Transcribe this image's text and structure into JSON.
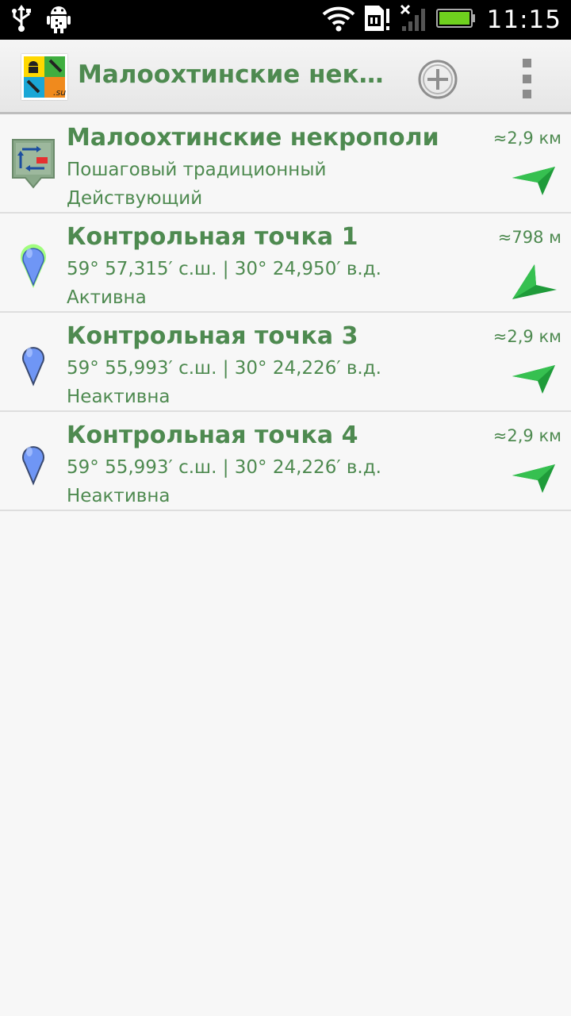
{
  "status_bar": {
    "time": "11:15",
    "icons": [
      "usb-icon",
      "android-debug-icon",
      "wifi-icon",
      "sim-icon",
      "signal-icon",
      "battery-icon"
    ]
  },
  "action_bar": {
    "title": "Малоохтинские нек…",
    "icons": [
      "app-logo-icon",
      "add-circle-icon",
      "overflow-menu-icon"
    ]
  },
  "colors": {
    "text_green": "#4e8a50",
    "arrow_green": "#1f9b3a",
    "pin_blue": "#6f96f5"
  },
  "items": [
    {
      "icon": "multistage-cache-icon",
      "title": "Малоохтинские некрополи",
      "line2": "Пошаговый традиционный",
      "line3": "Действующий",
      "distance": "≈2,9 км",
      "direction_icon": "direction-arrow-icon"
    },
    {
      "icon": "active-map-pin-icon",
      "title": "Контрольная точка 1",
      "line2": "59° 57,315′ с.ш. | 30° 24,950′ в.д.",
      "line3": "Активна",
      "distance": "≈798 м",
      "direction_icon": "direction-arrow-icon"
    },
    {
      "icon": "map-pin-icon",
      "title": "Контрольная точка 3",
      "line2": "59° 55,993′ с.ш. | 30° 24,226′ в.д.",
      "line3": "Неактивна",
      "distance": "≈2,9 км",
      "direction_icon": "direction-arrow-icon"
    },
    {
      "icon": "map-pin-icon",
      "title": "Контрольная точка 4",
      "line2": "59° 55,993′ с.ш. | 30° 24,226′ в.д.",
      "line3": "Неактивна",
      "distance": "≈2,9 км",
      "direction_icon": "direction-arrow-icon"
    }
  ]
}
